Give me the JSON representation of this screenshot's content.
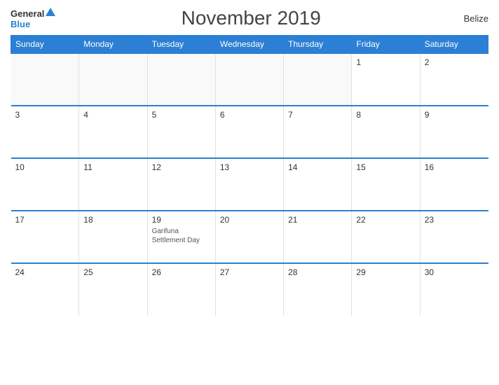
{
  "header": {
    "logo_general": "General",
    "logo_blue": "Blue",
    "title": "November 2019",
    "country": "Belize"
  },
  "days_of_week": [
    "Sunday",
    "Monday",
    "Tuesday",
    "Wednesday",
    "Thursday",
    "Friday",
    "Saturday"
  ],
  "weeks": [
    [
      {
        "day": "",
        "empty": true
      },
      {
        "day": "",
        "empty": true
      },
      {
        "day": "",
        "empty": true
      },
      {
        "day": "",
        "empty": true
      },
      {
        "day": "",
        "empty": true
      },
      {
        "day": "1",
        "empty": false,
        "event": ""
      },
      {
        "day": "2",
        "empty": false,
        "event": ""
      }
    ],
    [
      {
        "day": "3",
        "empty": false,
        "event": ""
      },
      {
        "day": "4",
        "empty": false,
        "event": ""
      },
      {
        "day": "5",
        "empty": false,
        "event": ""
      },
      {
        "day": "6",
        "empty": false,
        "event": ""
      },
      {
        "day": "7",
        "empty": false,
        "event": ""
      },
      {
        "day": "8",
        "empty": false,
        "event": ""
      },
      {
        "day": "9",
        "empty": false,
        "event": ""
      }
    ],
    [
      {
        "day": "10",
        "empty": false,
        "event": ""
      },
      {
        "day": "11",
        "empty": false,
        "event": ""
      },
      {
        "day": "12",
        "empty": false,
        "event": ""
      },
      {
        "day": "13",
        "empty": false,
        "event": ""
      },
      {
        "day": "14",
        "empty": false,
        "event": ""
      },
      {
        "day": "15",
        "empty": false,
        "event": ""
      },
      {
        "day": "16",
        "empty": false,
        "event": ""
      }
    ],
    [
      {
        "day": "17",
        "empty": false,
        "event": ""
      },
      {
        "day": "18",
        "empty": false,
        "event": ""
      },
      {
        "day": "19",
        "empty": false,
        "event": "Garifuna Settlement Day"
      },
      {
        "day": "20",
        "empty": false,
        "event": ""
      },
      {
        "day": "21",
        "empty": false,
        "event": ""
      },
      {
        "day": "22",
        "empty": false,
        "event": ""
      },
      {
        "day": "23",
        "empty": false,
        "event": ""
      }
    ],
    [
      {
        "day": "24",
        "empty": false,
        "event": ""
      },
      {
        "day": "25",
        "empty": false,
        "event": ""
      },
      {
        "day": "26",
        "empty": false,
        "event": ""
      },
      {
        "day": "27",
        "empty": false,
        "event": ""
      },
      {
        "day": "28",
        "empty": false,
        "event": ""
      },
      {
        "day": "29",
        "empty": false,
        "event": ""
      },
      {
        "day": "30",
        "empty": false,
        "event": ""
      }
    ]
  ]
}
